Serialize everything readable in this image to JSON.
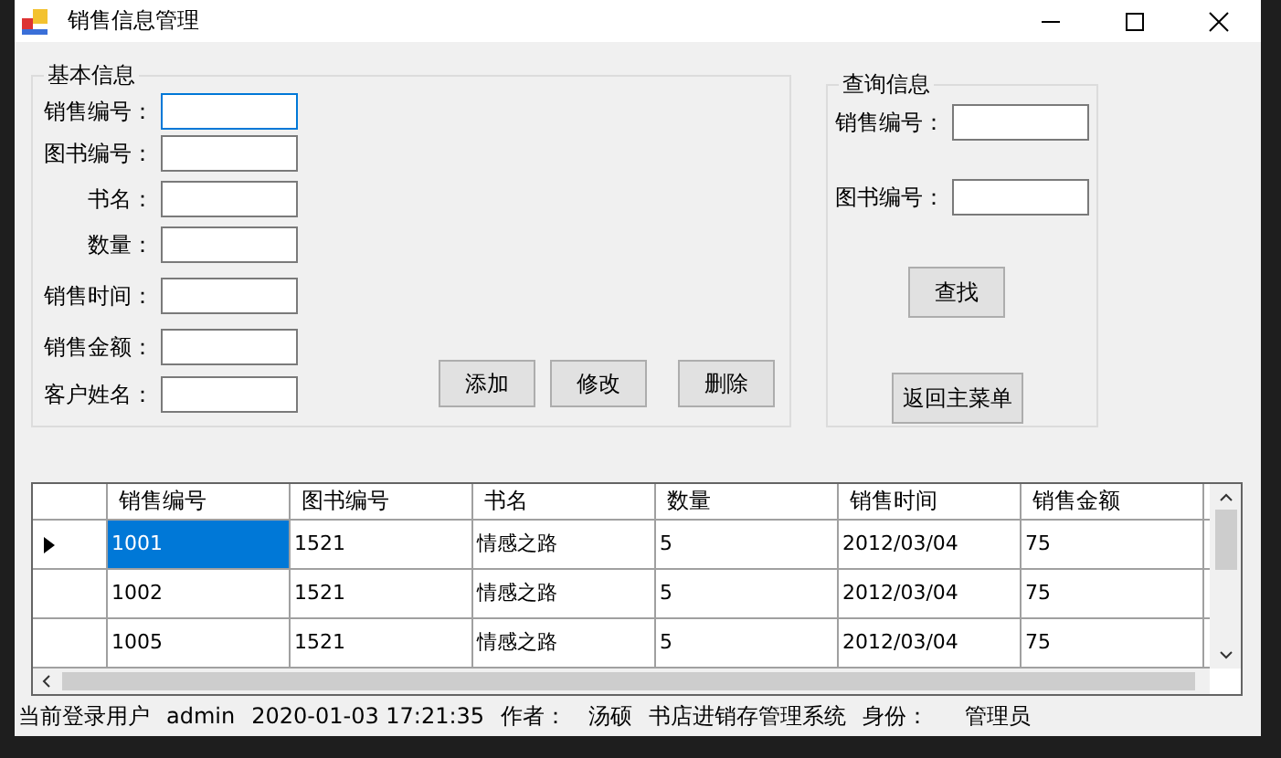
{
  "window": {
    "title": "销售信息管理"
  },
  "basic_info": {
    "title": "基本信息",
    "fields": [
      {
        "label": "销售编号：",
        "focused": true
      },
      {
        "label": "图书编号：",
        "focused": false
      },
      {
        "label": "书名：",
        "focused": false
      },
      {
        "label": "数量：",
        "focused": false
      },
      {
        "label": "销售时间：",
        "focused": false
      },
      {
        "label": "销售金额：",
        "focused": false
      },
      {
        "label": "客户姓名：",
        "focused": false
      }
    ],
    "buttons": [
      "添加",
      "修改",
      "删除"
    ]
  },
  "query": {
    "title": "查询信息",
    "fields": [
      {
        "label": "销售编号："
      },
      {
        "label": "图书编号："
      }
    ],
    "search_button": "查找",
    "back_button": "返回主菜单"
  },
  "table": {
    "columns": [
      "销售编号",
      "图书编号",
      "书名",
      "数量",
      "销售时间",
      "销售金额"
    ],
    "rows": [
      {
        "selected": true,
        "cells": [
          "1001",
          "1521",
          "情感之路",
          "5",
          "2012/03/04",
          "75"
        ]
      },
      {
        "selected": false,
        "cells": [
          "1002",
          "1521",
          "情感之路",
          "5",
          "2012/03/04",
          "75"
        ]
      },
      {
        "selected": false,
        "cells": [
          "1005",
          "1521",
          "情感之路",
          "5",
          "2012/03/04",
          "75"
        ]
      }
    ]
  },
  "status_bar": [
    "当前登录用户",
    "admin",
    "2020-01-03 17:21:35",
    "作者：",
    "汤硕",
    "书店进销存管理系统",
    "身份：",
    "管理员"
  ]
}
